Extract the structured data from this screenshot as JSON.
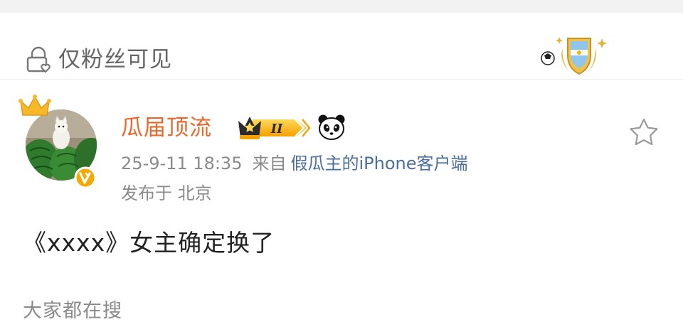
{
  "visibility": {
    "label": "仅粉丝可见",
    "icon": "lock-heart-icon"
  },
  "post": {
    "username": "瓜届顶流",
    "member_level": "II",
    "timestamp": "25-9-11 18:35",
    "source_prefix": "来自",
    "client": "假瓜主的iPhone客户端",
    "location": "发布于 北京",
    "text": "《xxxx》女主确定换了"
  },
  "section": {
    "title": "大家都在搜"
  },
  "colors": {
    "username": "#e8682c",
    "link": "#4a6e9c",
    "meta": "#8a8a8a",
    "badge_gold": "#f5b400"
  }
}
